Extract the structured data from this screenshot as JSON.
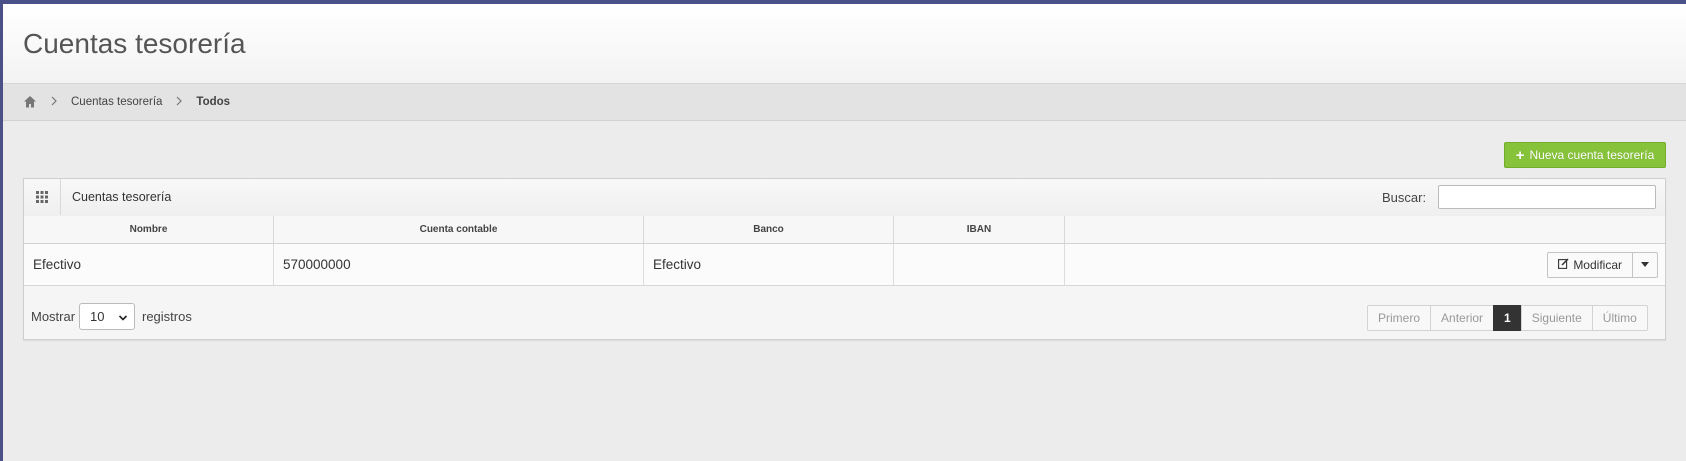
{
  "header": {
    "title": "Cuentas tesorería"
  },
  "breadcrumb": {
    "items": [
      "Cuentas tesorería",
      "Todos"
    ]
  },
  "toolbar": {
    "new_label": "Nueva cuenta tesorería"
  },
  "panel": {
    "title": "Cuentas tesorería",
    "search_label": "Buscar:",
    "search_value": ""
  },
  "table": {
    "columns": [
      "Nombre",
      "Cuenta contable",
      "Banco",
      "IBAN",
      ""
    ],
    "rows": [
      {
        "nombre": "Efectivo",
        "cuenta": "570000000",
        "banco": "Efectivo",
        "iban": "",
        "action": "Modificar"
      }
    ]
  },
  "footer": {
    "show_label": "Mostrar",
    "page_size": "10",
    "records_label": "registros"
  },
  "pagination": {
    "first": "Primero",
    "prev": "Anterior",
    "current": "1",
    "next": "Siguiente",
    "last": "Último"
  },
  "colors": {
    "accent_green": "#87c33a",
    "frame": "#4a5088"
  }
}
